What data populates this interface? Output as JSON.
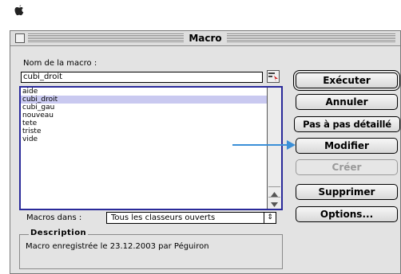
{
  "dialog": {
    "title": "Macro"
  },
  "name_label": "Nom de la macro :",
  "name_value": "cubi_droit",
  "macros": [
    {
      "label": "aide",
      "selected": false
    },
    {
      "label": "cubi_droit",
      "selected": true
    },
    {
      "label": "cubi_gau",
      "selected": false
    },
    {
      "label": "nouveau",
      "selected": false
    },
    {
      "label": "tete",
      "selected": false
    },
    {
      "label": "triste",
      "selected": false
    },
    {
      "label": "vide",
      "selected": false
    }
  ],
  "buttons": {
    "executer": "Exécuter",
    "annuler": "Annuler",
    "pas_a_pas": "Pas à pas détaillé",
    "modifier": "Modifier",
    "creer": "Créer",
    "supprimer": "Supprimer",
    "options": "Options..."
  },
  "macros_in_label": "Macros dans :",
  "macros_in_value": "Tous les classeurs ouverts",
  "description": {
    "title": "Description",
    "text": "Macro enregistrée le 23.12.2003 par Péguiron"
  },
  "colors": {
    "selection": "#c9c9f0",
    "list_border": "#2a2a9a",
    "annotation_arrow": "#3a8fd8"
  }
}
